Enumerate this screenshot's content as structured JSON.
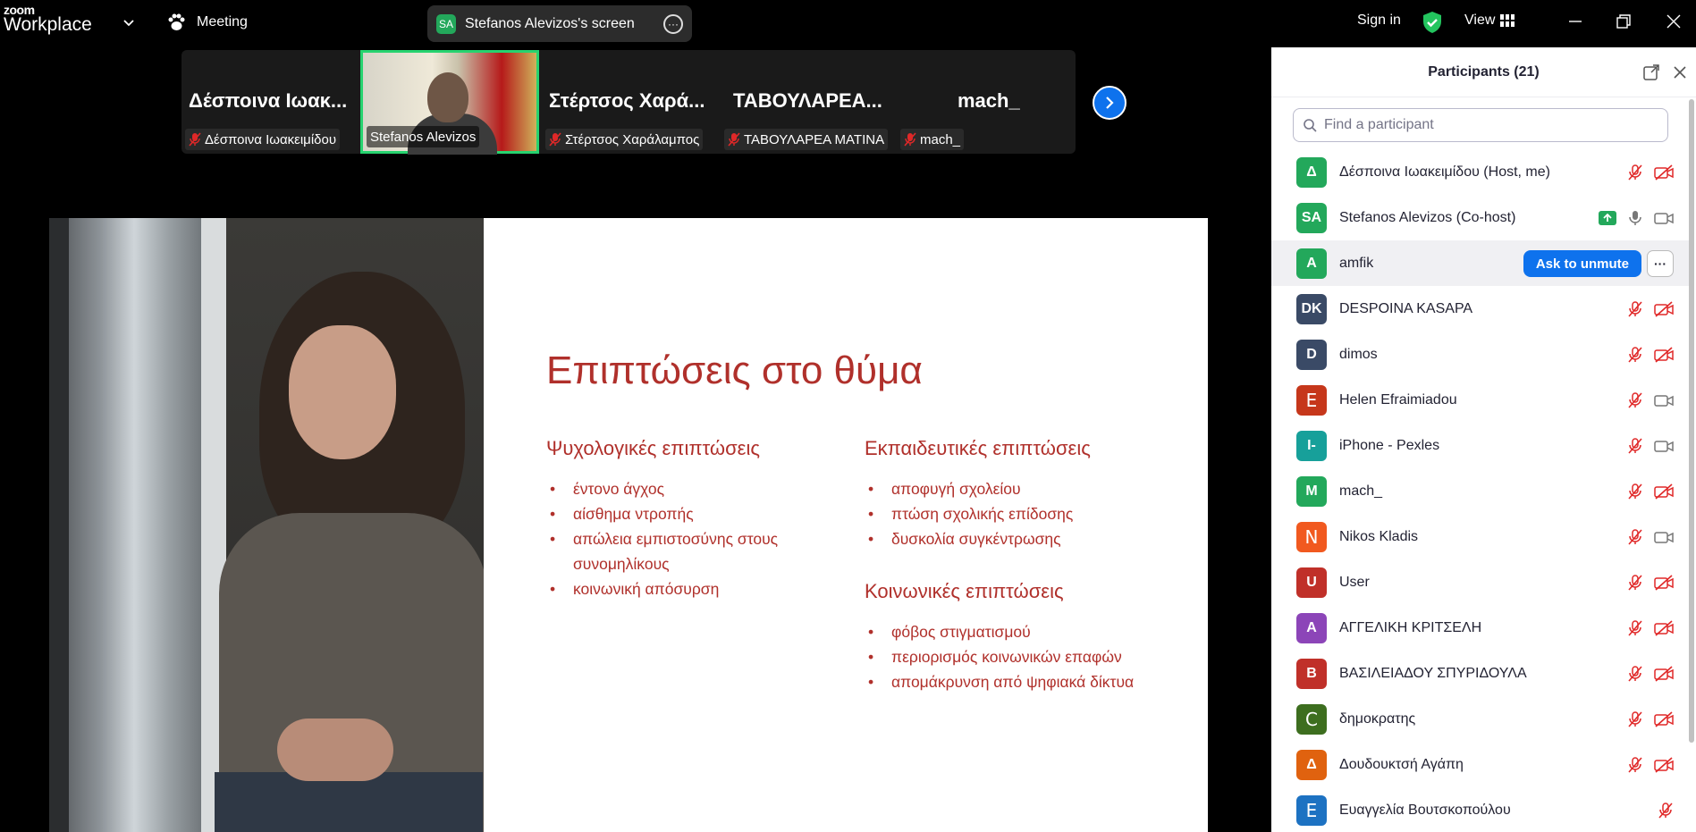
{
  "app": {
    "logo_top": "zoom",
    "logo_bottom": "Workplace",
    "meeting_label": "Meeting"
  },
  "screen_share": {
    "badge": "SA",
    "label": "Stefanos Alevizos's screen"
  },
  "topbar": {
    "sign_in": "Sign in",
    "view": "View"
  },
  "thumbnails": [
    {
      "big": "Δέσποινα Ιωακ...",
      "tag": "Δέσποινα Ιωακειμίδου",
      "muted": true
    },
    {
      "big": "",
      "tag": "Stefanos Alevizos",
      "muted": false,
      "active": true
    },
    {
      "big": "Στέρτσος Χαρά...",
      "tag": "Στέρτσος Χαράλαμπος",
      "muted": true
    },
    {
      "big": "ΤΑΒΟΥΛΑΡΕΑ...",
      "tag": "ΤΑΒΟΥΛΑΡΕΑ ΜΑΤΙΝΑ",
      "muted": true
    },
    {
      "big": "mach_",
      "tag": "mach_",
      "muted": true
    }
  ],
  "slide": {
    "title": "Επιπτώσεις στο θύμα",
    "psych": {
      "heading": "Ψυχολογικές επιπτώσεις",
      "items": [
        "έντονο άγχος",
        "αίσθημα ντροπής",
        "απώλεια εμπιστοσύνης στους συνομηλίκους",
        "κοινωνική απόσυρση"
      ]
    },
    "edu": {
      "heading": "Εκπαιδευτικές επιπτώσεις",
      "items": [
        "αποφυγή σχολείου",
        "πτώση σχολικής επίδοσης",
        "δυσκολία συγκέντρωσης"
      ]
    },
    "social": {
      "heading": "Κοινωνικές επιπτώσεις",
      "items": [
        "φόβος στιγματισμού",
        "περιορισμός κοινωνικών επαφών",
        "απομάκρυνση από ψηφιακά δίκτυα"
      ]
    }
  },
  "participants": {
    "title": "Participants (21)",
    "search_placeholder": "Find a participant",
    "ask_to_unmute": "Ask to unmute",
    "more": "···",
    "list": [
      {
        "initials": "Δ",
        "name": "Δέσποινα Ιωακειμίδου (Host, me)",
        "color": "#23a85b",
        "mic": "muted",
        "cam": "off"
      },
      {
        "initials": "SA",
        "name": "Stefanos Alevizos (Co-host)",
        "color": "#23a85b",
        "mic": "on",
        "cam": "on",
        "sharing": true
      },
      {
        "initials": "A",
        "name": "amfik",
        "color": "#23a85b",
        "mic": "none",
        "cam": "none",
        "hover": true
      },
      {
        "initials": "DK",
        "name": "DESPOINA KASAPA",
        "color": "#3a4a66",
        "mic": "muted",
        "cam": "off"
      },
      {
        "initials": "D",
        "name": "dimos",
        "color": "#3a4a66",
        "mic": "muted",
        "cam": "off"
      },
      {
        "initials": "E",
        "name": "Helen Efraimiadou",
        "color": "#c6371b",
        "mic": "muted",
        "cam": "on"
      },
      {
        "initials": "I-",
        "name": "iPhone - Pexles",
        "color": "#17a09a",
        "mic": "muted",
        "cam": "on"
      },
      {
        "initials": "M",
        "name": "mach_",
        "color": "#23a85b",
        "mic": "muted",
        "cam": "off"
      },
      {
        "initials": "N",
        "name": "Nikos Kladis",
        "color": "#f1591f",
        "mic": "muted",
        "cam": "on"
      },
      {
        "initials": "U",
        "name": "User",
        "color": "#c03029",
        "mic": "muted",
        "cam": "off"
      },
      {
        "initials": "A",
        "name": "ΑΓΓΕΛΙΚΗ ΚΡΙΤΣΕΛΗ",
        "color": "#8c45b8",
        "mic": "muted",
        "cam": "off"
      },
      {
        "initials": "B",
        "name": "ΒΑΣΙΛΕΙΑΔΟΥ ΣΠΥΡΙΔΟΥΛΑ",
        "color": "#c03029",
        "mic": "muted",
        "cam": "off"
      },
      {
        "initials": "C",
        "name": "δημοκρατης",
        "color": "#3d6e1f",
        "mic": "muted",
        "cam": "off"
      },
      {
        "initials": "Δ",
        "name": "Δουδουκτσή Αγάπη",
        "color": "#e0620f",
        "mic": "muted",
        "cam": "off"
      },
      {
        "initials": "E",
        "name": "Ευαγγελία Βουτσκοπούλου",
        "color": "#1d72c2",
        "mic": "muted",
        "cam": "none"
      }
    ]
  },
  "colors": {
    "accent": "#0e72ed",
    "slide_red": "#b0302b",
    "active_border": "#27d36f",
    "mute_red": "#e02828"
  }
}
